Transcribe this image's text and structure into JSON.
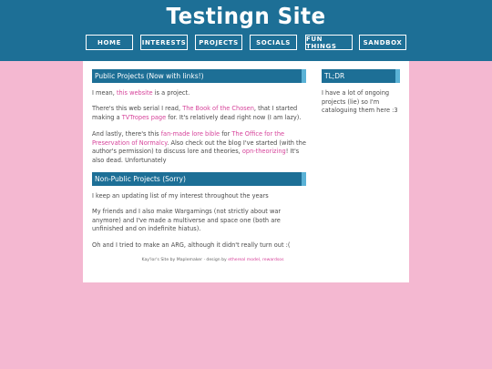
{
  "site": {
    "title": "Testingn Site"
  },
  "nav": [
    "HOME",
    "INTERESTS",
    "PROJECTS",
    "SOCIALS",
    "FUN THINGS",
    "SANDBOX"
  ],
  "main": {
    "section1_title": "Public Projects (Now with links!)",
    "p1": {
      "a": "I mean, ",
      "link": "this website",
      "b": " is a project."
    },
    "p2": {
      "a": "There's this web serial I read, ",
      "link1": "The Book of the Chosen",
      "b": ", that I started making a ",
      "link2": "TVTropes page",
      "c": " for. It's relatively dead right now (I am lazy)."
    },
    "p3": {
      "a": "And lastly, there's this ",
      "link1": "fan-made lore bible",
      "b": " for ",
      "link2": "The Office for the Preservation of Normalcy",
      "c": ". Also check out the blog I've started (with the author's permission) to discuss lore and theories, ",
      "link3": "opn-theorizing",
      "d": "! It's also dead. Unfortunately"
    },
    "section2_title": "Non-Public Projects (Sorry)",
    "p4": "I keep an updating list of my interest throughout the years",
    "p5": "My friends and I also make Wargamings (not strictly about war anymore) and I've made a multiverse and space one (both are unfinished and on indefinite hiatus).",
    "p6": "Oh and I tried to make an ARG, although it didn't really turn out :(",
    "footer": {
      "a": "Kay'lor's Site by Maplemaker · design by ",
      "link": "ethereal model, rewardsos"
    }
  },
  "sidebar": {
    "title": "TL;DR",
    "text": "I have a lot of ongoing projects (lie) so I'm cataloguing them here :3"
  }
}
